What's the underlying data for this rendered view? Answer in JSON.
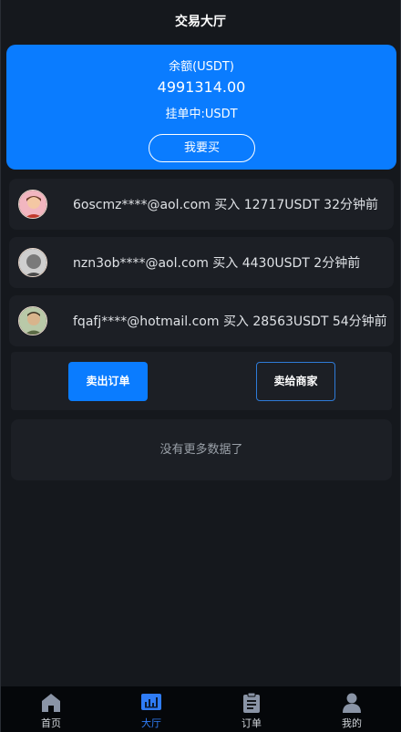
{
  "header": {
    "title": "交易大厅"
  },
  "balance": {
    "label": "余额(USDT)",
    "value": "4991314.00",
    "pending": "挂单中:USDT",
    "buy_label": "我要买"
  },
  "feed": [
    {
      "text": "6oscmz****@aol.com 买入 12717USDT 32分钟前"
    },
    {
      "text": "nzn3ob****@aol.com 买入 4430USDT 2分钟前"
    },
    {
      "text": "fqafj****@hotmail.com 买入 28563USDT 54分钟前"
    }
  ],
  "actions": {
    "sell_order": "卖出订单",
    "sell_merchant": "卖给商家"
  },
  "empty_text": "没有更多数据了",
  "tabs": [
    {
      "label": "首页",
      "icon": "home-icon"
    },
    {
      "label": "大厅",
      "icon": "hall-icon",
      "active": true
    },
    {
      "label": "订单",
      "icon": "order-icon"
    },
    {
      "label": "我的",
      "icon": "user-icon"
    }
  ],
  "colors": {
    "accent": "#0a7cff",
    "background": "#15181d",
    "card": "#1c1f25"
  }
}
